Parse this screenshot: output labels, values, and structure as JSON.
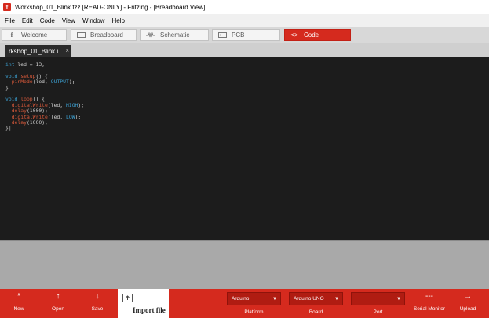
{
  "window": {
    "title": "Workshop_01_Blink.fzz [READ-ONLY]  - Fritzing - [Breadboard View]",
    "app_icon": "f"
  },
  "menu": [
    "File",
    "Edit",
    "Code",
    "View",
    "Window",
    "Help"
  ],
  "tabs": [
    {
      "label": "Welcome",
      "icon": "fritzing-f-icon",
      "glyph": "f",
      "active": false
    },
    {
      "label": "Breadboard",
      "icon": "breadboard-icon",
      "glyph": "▬",
      "active": false
    },
    {
      "label": "Schematic",
      "icon": "schematic-icon",
      "glyph": "⏦",
      "active": false
    },
    {
      "label": "PCB",
      "icon": "pcb-icon",
      "glyph": "▭",
      "active": false
    },
    {
      "label": "Code",
      "icon": "code-icon",
      "glyph": "<>",
      "active": true
    }
  ],
  "editor": {
    "file_tab_label": "rkshop_01_Blink.i",
    "file_tab_close": "×"
  },
  "bottom_bar": {
    "tools": [
      {
        "label": "New",
        "icon": "new-icon",
        "glyph": "*"
      },
      {
        "label": "Open",
        "icon": "open-icon",
        "glyph": "↑"
      },
      {
        "label": "Save",
        "icon": "save-icon",
        "glyph": "↓"
      }
    ],
    "import_label": "Import file",
    "platform": {
      "value": "Arduino",
      "label": "Platform"
    },
    "board": {
      "value": "Arduino UNO",
      "label": "Board"
    },
    "port": {
      "value": "",
      "label": "Port"
    },
    "serial_monitor": {
      "label": "Serial Monitor",
      "glyph": "---"
    },
    "upload": {
      "label": "Upload",
      "glyph": "→"
    }
  },
  "colors": {
    "accent": "#d52a1e",
    "editor_bg": "#1c1c1c",
    "keyword": "#3c9fd0",
    "function": "#d9593a"
  }
}
